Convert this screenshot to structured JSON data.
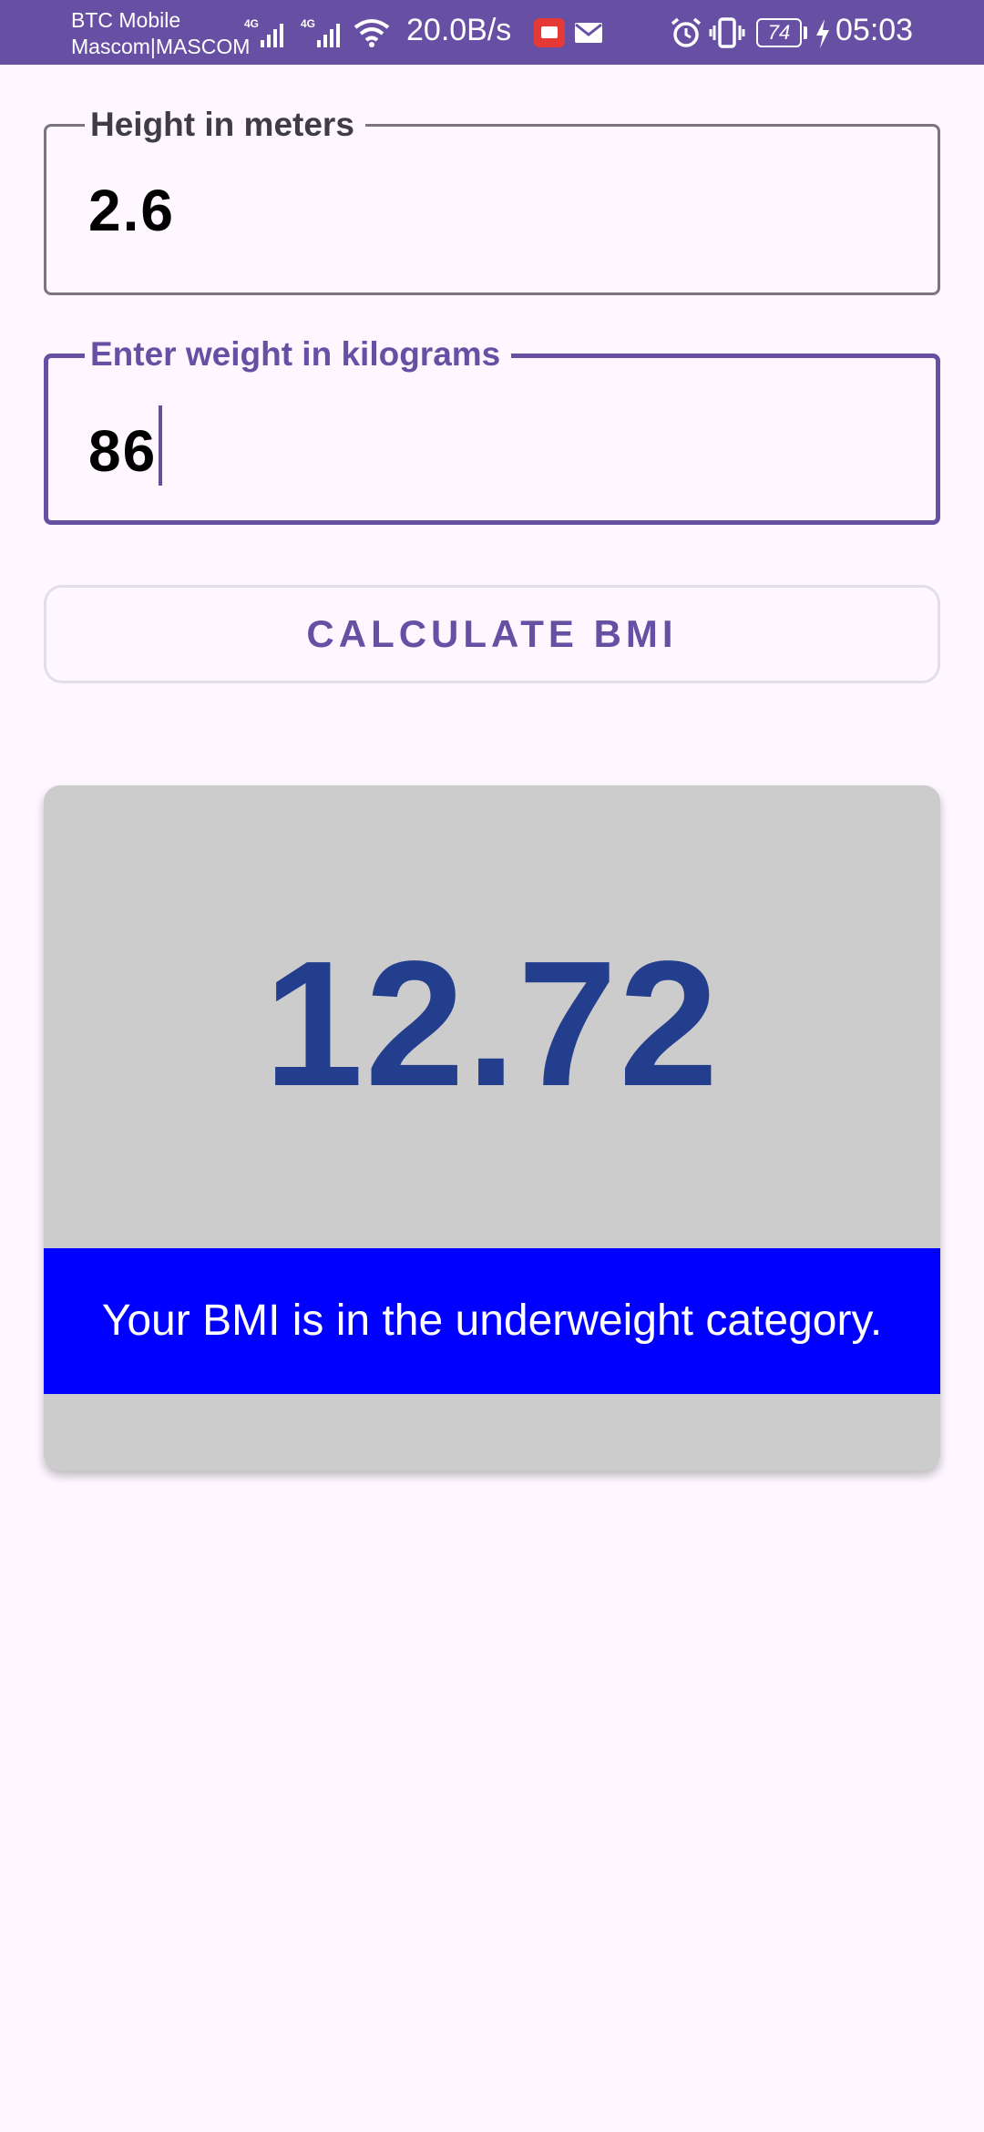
{
  "status_bar": {
    "carrier_line1": "BTC Mobile",
    "carrier_line2": "Mascom|MASCOM",
    "network1": "4G",
    "network2": "4G",
    "net_speed": "20.0B/s",
    "battery_level": "74",
    "time": "05:03",
    "icons": [
      "signal-icon",
      "signal-icon",
      "wifi-icon",
      "notification-icon",
      "mail-icon",
      "alarm-icon",
      "vibrate-icon",
      "battery-icon",
      "charging-icon"
    ]
  },
  "form": {
    "height_label": "Height in meters",
    "height_value": "2.6",
    "weight_label": "Enter weight in kilograms",
    "weight_value": "86",
    "calculate_label": "CALCULATE BMI"
  },
  "result": {
    "bmi_value": "12.72",
    "category_message": "Your BMI is in the underweight category."
  },
  "colors": {
    "primary": "#6750a4",
    "background": "#fef7ff",
    "card": "#cccccc",
    "bmi_text": "#243e8e",
    "banner": "#0000ff"
  }
}
